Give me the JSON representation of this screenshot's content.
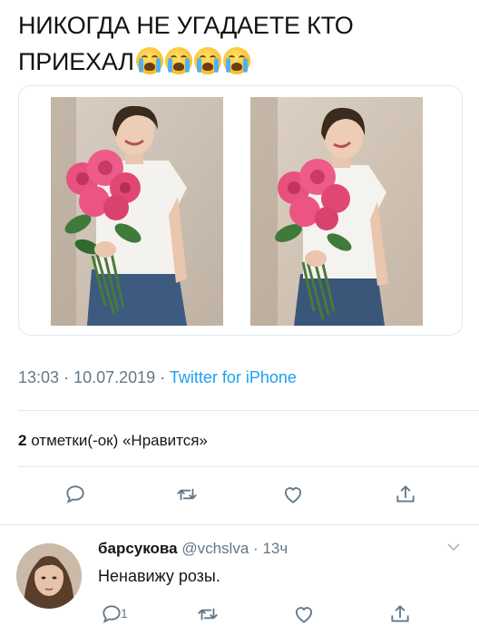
{
  "tweet": {
    "text_line1": "НИКОГДА НЕ УГАДАЕТЕ КТО",
    "text_line2": "ПРИЕХАЛ",
    "emojis": [
      "loudly-crying-face",
      "loudly-crying-face",
      "loudly-crying-face",
      "loudly-crying-face"
    ],
    "time": "13:03",
    "sep": "·",
    "date": "10.07.2019",
    "source": "Twitter for iPhone",
    "likes_count": "2",
    "likes_label": "отметки(-ок) «Нравится»"
  },
  "actions": {
    "icons": [
      "reply-icon",
      "retweet-icon",
      "like-icon",
      "share-icon"
    ]
  },
  "reply": {
    "name": "барсукова",
    "handle": "@vchslva",
    "sep": "·",
    "time": "13ч",
    "text": "Ненавижу розы.",
    "reply_count": "1"
  },
  "colors": {
    "accent": "#1da1f2",
    "muted": "#657786",
    "border": "#e1e8ed",
    "rose": "#e8507f"
  }
}
